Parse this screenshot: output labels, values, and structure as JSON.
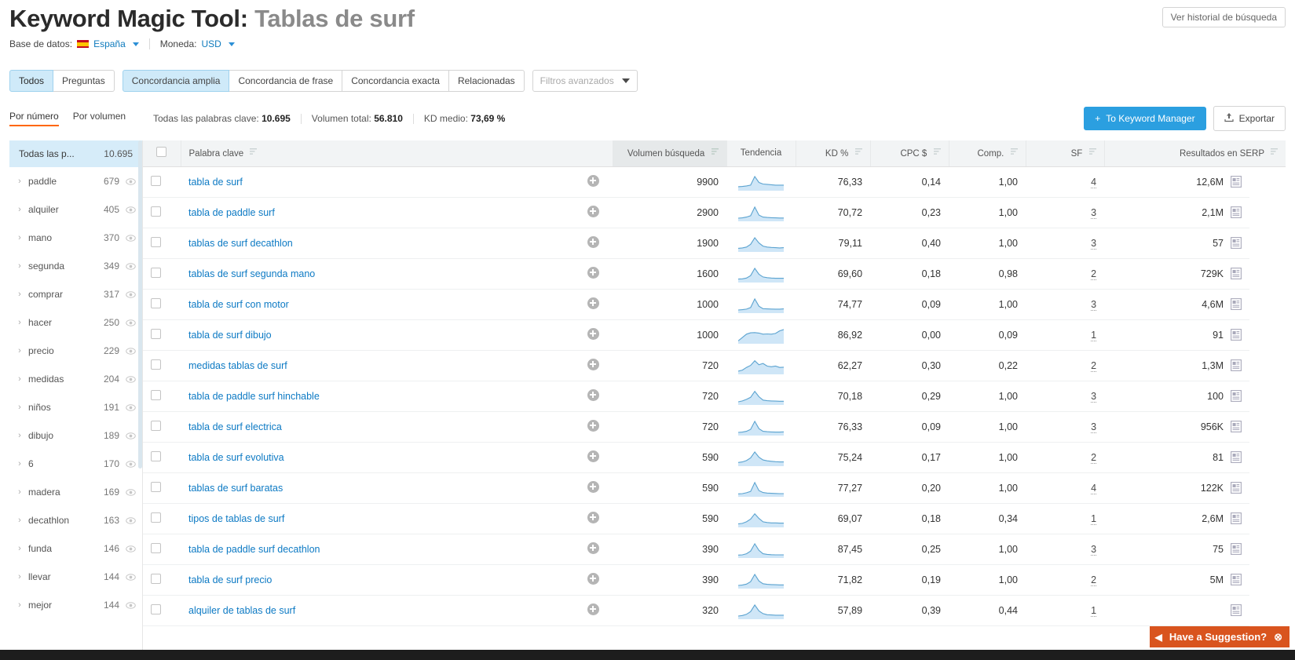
{
  "header": {
    "title_tool": "Keyword Magic Tool:",
    "title_query": "Tablas de surf",
    "history_button": "Ver historial de búsqueda",
    "database_label": "Base de datos:",
    "database_value": "España",
    "currency_label": "Moneda:",
    "currency_value": "USD"
  },
  "filters": {
    "buttons": [
      "Todos",
      "Preguntas"
    ],
    "match_buttons": [
      "Concordancia amplia",
      "Concordancia de frase",
      "Concordancia exacta",
      "Relacionadas"
    ],
    "selected_match": "Concordancia amplia",
    "selected_button": "Todos",
    "advanced_placeholder": "Filtros avanzados"
  },
  "stats": {
    "tabs": [
      "Por número",
      "Por volumen"
    ],
    "active_tab": "Por número",
    "all_keywords_label": "Todas las palabras clave:",
    "all_keywords_value": "10.695",
    "total_volume_label": "Volumen total:",
    "total_volume_value": "56.810",
    "kd_label": "KD medio:",
    "kd_value": "73,69 %",
    "to_keyword_manager": "To Keyword Manager",
    "export": "Exportar"
  },
  "sidebar": {
    "head": {
      "label": "Todas las p...",
      "count": "10.695"
    },
    "items": [
      {
        "label": "paddle",
        "count": "679"
      },
      {
        "label": "alquiler",
        "count": "405"
      },
      {
        "label": "mano",
        "count": "370"
      },
      {
        "label": "segunda",
        "count": "349"
      },
      {
        "label": "comprar",
        "count": "317"
      },
      {
        "label": "hacer",
        "count": "250"
      },
      {
        "label": "precio",
        "count": "229"
      },
      {
        "label": "medidas",
        "count": "204"
      },
      {
        "label": "niños",
        "count": "191"
      },
      {
        "label": "dibujo",
        "count": "189"
      },
      {
        "label": "6",
        "count": "170"
      },
      {
        "label": "madera",
        "count": "169"
      },
      {
        "label": "decathlon",
        "count": "163"
      },
      {
        "label": "funda",
        "count": "146"
      },
      {
        "label": "llevar",
        "count": "144"
      },
      {
        "label": "mejor",
        "count": "144"
      }
    ]
  },
  "table": {
    "columns": [
      "Palabra clave",
      "Volumen búsqueda",
      "Tendencia",
      "KD %",
      "CPC $",
      "Comp.",
      "SF",
      "Resultados en SERP"
    ],
    "rows": [
      {
        "keyword": "tabla de surf",
        "volume": "9900",
        "kd": "76,33",
        "cpc": "0,14",
        "comp": "1,00",
        "sf": "4",
        "serp": "12,6M",
        "trend": [
          0.18,
          0.2,
          0.24,
          0.3,
          0.95,
          0.5,
          0.38,
          0.36,
          0.33,
          0.3,
          0.3,
          0.3
        ]
      },
      {
        "keyword": "tabla de paddle surf",
        "volume": "2900",
        "kd": "70,72",
        "cpc": "0,23",
        "comp": "1,00",
        "sf": "3",
        "serp": "2,1M",
        "trend": [
          0.12,
          0.14,
          0.2,
          0.3,
          0.95,
          0.35,
          0.2,
          0.17,
          0.15,
          0.14,
          0.13,
          0.13
        ]
      },
      {
        "keyword": "tablas de surf decathlon",
        "volume": "1900",
        "kd": "79,11",
        "cpc": "0,40",
        "comp": "1,00",
        "sf": "3",
        "serp": "57",
        "trend": [
          0.15,
          0.18,
          0.25,
          0.45,
          0.95,
          0.55,
          0.32,
          0.25,
          0.22,
          0.2,
          0.18,
          0.2
        ]
      },
      {
        "keyword": "tablas de surf segunda mano",
        "volume": "1600",
        "kd": "69,60",
        "cpc": "0,18",
        "comp": "0,98",
        "sf": "2",
        "serp": "729K",
        "trend": [
          0.14,
          0.16,
          0.22,
          0.4,
          0.95,
          0.5,
          0.3,
          0.25,
          0.22,
          0.2,
          0.2,
          0.2
        ]
      },
      {
        "keyword": "tabla de surf con motor",
        "volume": "1000",
        "kd": "74,77",
        "cpc": "0,09",
        "comp": "1,00",
        "sf": "3",
        "serp": "4,6M",
        "trend": [
          0.12,
          0.14,
          0.18,
          0.3,
          0.95,
          0.4,
          0.22,
          0.2,
          0.19,
          0.18,
          0.18,
          0.2
        ]
      },
      {
        "keyword": "tabla de surf dibujo",
        "volume": "1000",
        "kd": "86,92",
        "cpc": "0,00",
        "comp": "0,09",
        "sf": "1",
        "serp": "91",
        "trend": [
          0.1,
          0.35,
          0.6,
          0.7,
          0.72,
          0.68,
          0.6,
          0.62,
          0.6,
          0.65,
          0.85,
          0.95
        ]
      },
      {
        "keyword": "medidas tablas de surf",
        "volume": "720",
        "kd": "62,27",
        "cpc": "0,30",
        "comp": "0,22",
        "sf": "2",
        "serp": "1,3M",
        "trend": [
          0.12,
          0.2,
          0.4,
          0.55,
          0.9,
          0.6,
          0.7,
          0.5,
          0.45,
          0.5,
          0.4,
          0.42
        ]
      },
      {
        "keyword": "tabla de paddle surf hinchable",
        "volume": "720",
        "kd": "70,18",
        "cpc": "0,29",
        "comp": "1,00",
        "sf": "3",
        "serp": "100",
        "trend": [
          0.12,
          0.18,
          0.3,
          0.45,
          0.9,
          0.5,
          0.25,
          0.2,
          0.18,
          0.17,
          0.16,
          0.16
        ]
      },
      {
        "keyword": "tabla de surf electrica",
        "volume": "720",
        "kd": "76,33",
        "cpc": "0,09",
        "comp": "1,00",
        "sf": "3",
        "serp": "956K",
        "trend": [
          0.12,
          0.14,
          0.2,
          0.35,
          0.95,
          0.4,
          0.2,
          0.17,
          0.15,
          0.14,
          0.14,
          0.16
        ]
      },
      {
        "keyword": "tabla de surf evolutiva",
        "volume": "590",
        "kd": "75,24",
        "cpc": "0,17",
        "comp": "1,00",
        "sf": "2",
        "serp": "81",
        "trend": [
          0.16,
          0.2,
          0.3,
          0.5,
          0.95,
          0.55,
          0.35,
          0.28,
          0.25,
          0.22,
          0.2,
          0.2
        ]
      },
      {
        "keyword": "tablas de surf baratas",
        "volume": "590",
        "kd": "77,27",
        "cpc": "0,20",
        "comp": "1,00",
        "sf": "4",
        "serp": "122K",
        "trend": [
          0.1,
          0.12,
          0.18,
          0.28,
          0.95,
          0.35,
          0.2,
          0.16,
          0.14,
          0.13,
          0.12,
          0.12
        ]
      },
      {
        "keyword": "tipos de tablas de surf",
        "volume": "590",
        "kd": "69,07",
        "cpc": "0,18",
        "comp": "0,34",
        "sf": "1",
        "serp": "2,6M",
        "trend": [
          0.14,
          0.18,
          0.3,
          0.5,
          0.9,
          0.55,
          0.3,
          0.25,
          0.22,
          0.22,
          0.2,
          0.2
        ]
      },
      {
        "keyword": "tabla de paddle surf decathlon",
        "volume": "390",
        "kd": "87,45",
        "cpc": "0,25",
        "comp": "1,00",
        "sf": "3",
        "serp": "75",
        "trend": [
          0.1,
          0.12,
          0.2,
          0.4,
          0.95,
          0.45,
          0.2,
          0.15,
          0.13,
          0.12,
          0.12,
          0.12
        ]
      },
      {
        "keyword": "tabla de surf precio",
        "volume": "390",
        "kd": "71,82",
        "cpc": "0,19",
        "comp": "1,00",
        "sf": "2",
        "serp": "5M",
        "trend": [
          0.12,
          0.15,
          0.22,
          0.4,
          0.95,
          0.45,
          0.25,
          0.2,
          0.18,
          0.17,
          0.16,
          0.16
        ]
      },
      {
        "keyword": "alquiler de tablas de surf",
        "volume": "320",
        "kd": "57,89",
        "cpc": "0,39",
        "comp": "0,44",
        "sf": "1",
        "serp": "",
        "trend": [
          0.12,
          0.16,
          0.25,
          0.45,
          0.95,
          0.5,
          0.3,
          0.22,
          0.2,
          0.18,
          0.18,
          0.18
        ]
      }
    ]
  },
  "footer": {
    "suggestion": "Have a Suggestion?"
  }
}
